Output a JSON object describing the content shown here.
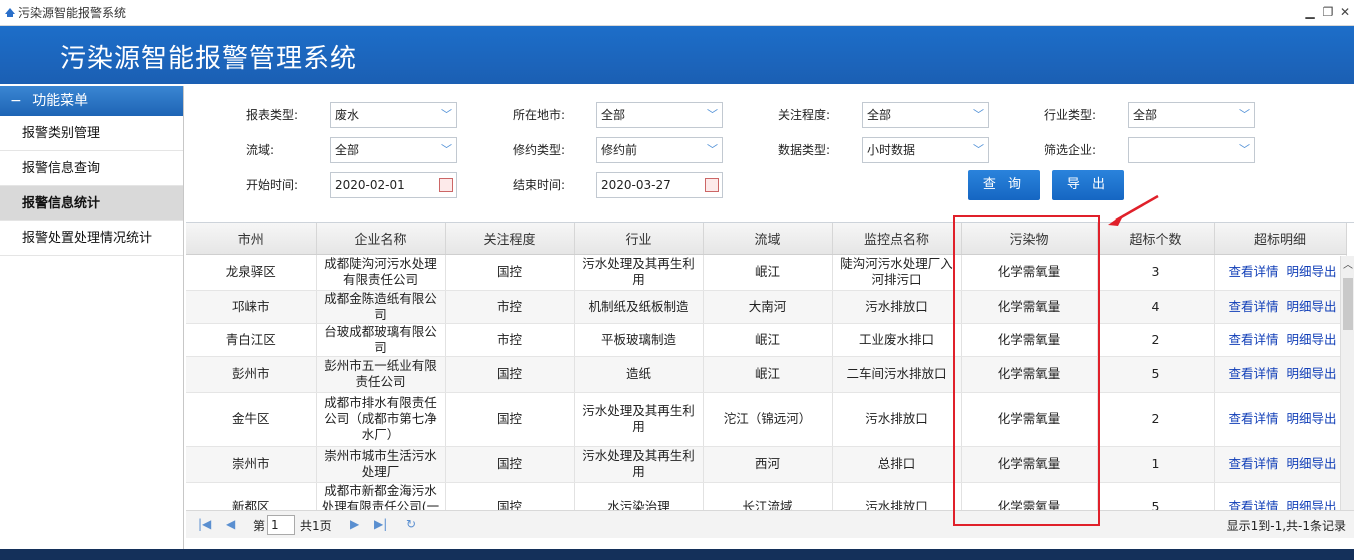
{
  "window": {
    "title": "污染源智能报警系统"
  },
  "header": {
    "title": "污染源智能报警管理系统"
  },
  "sidebar": {
    "menu_title": "功能菜单",
    "items": [
      {
        "label": "报警类别管理"
      },
      {
        "label": "报警信息查询"
      },
      {
        "label": "报警信息统计"
      },
      {
        "label": "报警处置处理情况统计"
      }
    ]
  },
  "filters": {
    "report_type": {
      "label": "报表类型:",
      "value": "废水"
    },
    "region": {
      "label": "所在地市:",
      "value": "全部"
    },
    "attention": {
      "label": "关注程度:",
      "value": "全部"
    },
    "industry": {
      "label": "行业类型:",
      "value": "全部"
    },
    "basin": {
      "label": "流域:",
      "value": "全部"
    },
    "revision": {
      "label": "修约类型:",
      "value": "修约前"
    },
    "data_type": {
      "label": "数据类型:",
      "value": "小时数据"
    },
    "company_filter": {
      "label": "筛选企业:",
      "value": ""
    },
    "start_time": {
      "label": "开始时间:",
      "value": "2020-02-01"
    },
    "end_time": {
      "label": "结束时间:",
      "value": "2020-03-27"
    },
    "query_label": "查 询",
    "export_label": "导 出"
  },
  "table": {
    "columns": [
      "市州",
      "企业名称",
      "关注程度",
      "行业",
      "流域",
      "监控点名称",
      "污染物",
      "超标个数",
      "超标明细"
    ],
    "rows": [
      {
        "city": "龙泉驿区",
        "company": "成都陡沟河污水处理有限责任公司",
        "attention": "国控",
        "industry": "污水处理及其再生利用",
        "basin": "岷江",
        "point": "陡沟河污水处理厂入河排污口",
        "pollutant": "化学需氧量",
        "count": "3"
      },
      {
        "city": "邛崃市",
        "company": "成都金陈造纸有限公司",
        "attention": "市控",
        "industry": "机制纸及纸板制造",
        "basin": "大南河",
        "point": "污水排放口",
        "pollutant": "化学需氧量",
        "count": "4"
      },
      {
        "city": "青白江区",
        "company": "台玻成都玻璃有限公司",
        "attention": "市控",
        "industry": "平板玻璃制造",
        "basin": "岷江",
        "point": "工业废水排口",
        "pollutant": "化学需氧量",
        "count": "2"
      },
      {
        "city": "彭州市",
        "company": "彭州市五一纸业有限责任公司",
        "attention": "国控",
        "industry": "造纸",
        "basin": "岷江",
        "point": "二车间污水排放口",
        "pollutant": "化学需氧量",
        "count": "5"
      },
      {
        "city": "金牛区",
        "company": "成都市排水有限责任公司（成都市第七净水厂）",
        "attention": "国控",
        "industry": "污水处理及其再生利用",
        "basin": "沱江（锦远河）",
        "point": "污水排放口",
        "pollutant": "化学需氧量",
        "count": "2"
      },
      {
        "city": "崇州市",
        "company": "崇州市城市生活污水处理厂",
        "attention": "国控",
        "industry": "污水处理及其再生利用",
        "basin": "西河",
        "point": "总排口",
        "pollutant": "化学需氧量",
        "count": "1"
      },
      {
        "city": "新都区",
        "company": "成都市新都金海污水处理有限责任公司(一厂)",
        "attention": "国控",
        "industry": "水污染治理",
        "basin": "长江流域",
        "point": "污水排放口",
        "pollutant": "化学需氧量",
        "count": "5"
      }
    ],
    "detail_link": "查看详情",
    "export_link": "明细导出"
  },
  "pager": {
    "page_prefix": "第",
    "page_value": "1",
    "page_suffix": "共1页",
    "summary": "显示1到-1,共-1条记录"
  }
}
